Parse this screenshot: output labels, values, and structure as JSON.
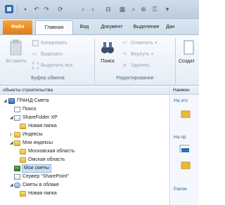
{
  "quick_access": {
    "undo_icon": "undo-arrow",
    "redo_icon": "redo-arrow"
  },
  "tabs": [
    {
      "label": "Файл",
      "state": "file"
    },
    {
      "label": "Главная",
      "state": "active"
    },
    {
      "label": "Вид",
      "state": "normal"
    },
    {
      "label": "Документ",
      "state": "normal"
    },
    {
      "label": "Выделение",
      "state": "normal"
    },
    {
      "label": "Дан",
      "state": "normal"
    }
  ],
  "ribbon": {
    "clipboard": {
      "paste": "Вставить",
      "copy": "Копировать",
      "cut": "Вырезать",
      "cut_all": "Выделить все",
      "group": "Буфер обмена"
    },
    "edit": {
      "search": "Поиск",
      "replace": "Отменить",
      "back": "Вернуть",
      "delete": "Удалить",
      "group": "Редактирование"
    },
    "create": {
      "label": "Создат"
    }
  },
  "tree": {
    "header": "объекты строительства",
    "items": [
      {
        "label": "ГРАНД-Смета"
      },
      {
        "label": "Поиск"
      },
      {
        "label": "ShareFolder XP"
      },
      {
        "label": "Новая папка"
      },
      {
        "label": "Индексы"
      },
      {
        "label": "Мои индексы"
      },
      {
        "label": "Московская область"
      },
      {
        "label": "Омская область"
      },
      {
        "label": "Мои сметы"
      },
      {
        "label": "Сервер \"SharePoint\""
      },
      {
        "label": "Сметы в облаке"
      },
      {
        "label": "Новая папка"
      }
    ]
  },
  "right_pane": {
    "header": "Наимен",
    "link1": "На это",
    "link2": "На пр",
    "link3": "Panoe"
  },
  "colors": {
    "file_tab": "#e98c1f",
    "selection": "#cde3f7",
    "ribbon_bg": "#eef3f9"
  }
}
